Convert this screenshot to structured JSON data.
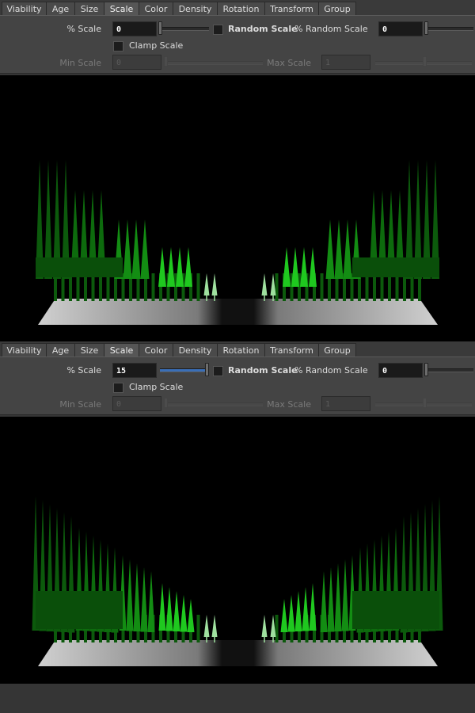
{
  "tabs": [
    "Viability",
    "Age",
    "Size",
    "Scale",
    "Color",
    "Density",
    "Rotation",
    "Transform",
    "Group"
  ],
  "active_tab": "Scale",
  "panels": [
    {
      "scale_label": "% Scale",
      "scale_value": "0",
      "scale_slider_fraction": 0,
      "random_scale_label": "Random Scale",
      "random_scale_checked": false,
      "pct_random_label": "% Random Scale",
      "pct_random_value": "0",
      "pct_random_slider_fraction": 0,
      "clamp_label": "Clamp Scale",
      "clamp_checked": false,
      "min_label": "Min Scale",
      "min_value": "0",
      "max_label": "Max Scale",
      "max_value": "1"
    },
    {
      "scale_label": "% Scale",
      "scale_value": "15",
      "scale_slider_fraction": 1,
      "random_scale_label": "Random Scale",
      "random_scale_checked": false,
      "pct_random_label": "% Random Scale",
      "pct_random_value": "0",
      "pct_random_slider_fraction": 0,
      "clamp_label": "Clamp Scale",
      "clamp_checked": false,
      "min_label": "Min Scale",
      "min_value": "0",
      "max_label": "Max Scale",
      "max_value": "1"
    }
  ],
  "viewports": [
    {
      "name": "viewport-scale-0",
      "scale_percent": 0
    },
    {
      "name": "viewport-scale-15",
      "scale_percent": 15
    }
  ],
  "colors": {
    "background": "#353535",
    "panel": "#444444",
    "viewport": "#000000",
    "tree_dark": "#0c5a0c",
    "tree_mid": "#138d13",
    "tree_bright": "#1fc81f",
    "tree_pale": "#9fe09f",
    "slider_fill": "#3a6fb8"
  }
}
